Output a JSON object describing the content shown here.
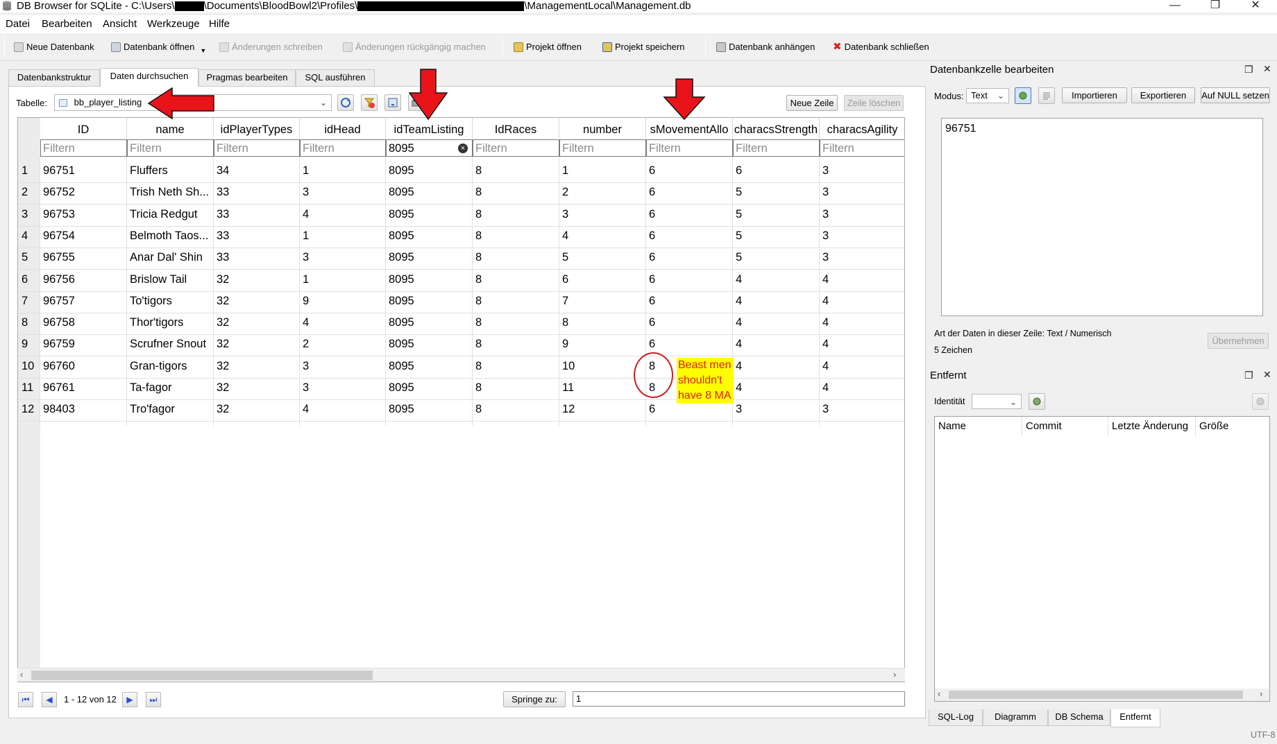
{
  "window": {
    "app_name": "DB Browser for SQLite",
    "title_part1": "DB Browser for SQLite - C:\\Users\\",
    "title_part2": "\\Documents\\BloodBowl2\\Profiles\\",
    "title_part3": "\\ManagementLocal\\Management.db",
    "minimize": "—",
    "restore": "❐",
    "close": "✕"
  },
  "menu": [
    "Datei",
    "Bearbeiten",
    "Ansicht",
    "Werkzeuge",
    "Hilfe"
  ],
  "toolbar": {
    "new_db": "Neue Datenbank",
    "open_db": "Datenbank öffnen",
    "write_changes": "Änderungen schreiben",
    "revert_changes": "Änderungen rückgängig machen",
    "open_project": "Projekt öffnen",
    "save_project": "Projekt speichern",
    "attach_db": "Datenbank anhängen",
    "close_db": "Datenbank schließen"
  },
  "tabs": [
    "Datenbankstruktur",
    "Daten durchsuchen",
    "Pragmas bearbeiten",
    "SQL ausführen"
  ],
  "browse": {
    "table_label": "Tabelle:",
    "table_value": "bb_player_listing",
    "new_row": "Neue Zeile",
    "delete_row": "Zeile löschen",
    "columns": [
      "ID",
      "name",
      "idPlayerTypes",
      "idHead",
      "idTeamListing",
      "IdRaces",
      "number",
      "sMovementAllo",
      "characsStrength",
      "characsAgility"
    ],
    "filters": [
      "Filtern",
      "Filtern",
      "Filtern",
      "Filtern",
      "8095",
      "Filtern",
      "Filtern",
      "Filtern",
      "Filtern",
      "Filtern"
    ],
    "rows": [
      [
        "1",
        "96751",
        "Fluffers",
        "34",
        "1",
        "8095",
        "8",
        "1",
        "6",
        "6",
        "3"
      ],
      [
        "2",
        "96752",
        "Trish Neth Sh...",
        "33",
        "3",
        "8095",
        "8",
        "2",
        "6",
        "5",
        "3"
      ],
      [
        "3",
        "96753",
        "Tricia Redgut",
        "33",
        "4",
        "8095",
        "8",
        "3",
        "6",
        "5",
        "3"
      ],
      [
        "4",
        "96754",
        "Belmoth Taos...",
        "33",
        "1",
        "8095",
        "8",
        "4",
        "6",
        "5",
        "3"
      ],
      [
        "5",
        "96755",
        "Anar Dal' Shin",
        "33",
        "3",
        "8095",
        "8",
        "5",
        "6",
        "5",
        "3"
      ],
      [
        "6",
        "96756",
        "Brislow Tail",
        "32",
        "1",
        "8095",
        "8",
        "6",
        "6",
        "4",
        "4"
      ],
      [
        "7",
        "96757",
        "To'tigors",
        "32",
        "9",
        "8095",
        "8",
        "7",
        "6",
        "4",
        "4"
      ],
      [
        "8",
        "96758",
        "Thor'tigors",
        "32",
        "4",
        "8095",
        "8",
        "8",
        "6",
        "4",
        "4"
      ],
      [
        "9",
        "96759",
        "Scrufner Snout",
        "32",
        "2",
        "8095",
        "8",
        "9",
        "6",
        "4",
        "4"
      ],
      [
        "10",
        "96760",
        "Gran-tigors",
        "32",
        "3",
        "8095",
        "8",
        "10",
        "8",
        "4",
        "4"
      ],
      [
        "11",
        "96761",
        "Ta-fagor",
        "32",
        "3",
        "8095",
        "8",
        "11",
        "8",
        "4",
        "4"
      ],
      [
        "12",
        "98403",
        "Tro'fagor",
        "32",
        "4",
        "8095",
        "8",
        "12",
        "6",
        "3",
        "3"
      ]
    ],
    "annotation_note": "Beast men shouldn't have 8 MA",
    "record_info": "1 - 12 von 12",
    "goto_label": "Springe zu:",
    "goto_value": "1"
  },
  "edit_cell": {
    "title": "Datenbankzelle bearbeiten",
    "mode_label": "Modus:",
    "mode_value": "Text",
    "import": "Importieren",
    "export": "Exportieren",
    "set_null": "Auf NULL setzen",
    "value": "96751",
    "type_info": "Art der Daten in dieser Zeile: Text / Numerisch",
    "char_count": "5 Zeichen",
    "apply": "Übernehmen"
  },
  "remote": {
    "title": "Entfernt",
    "identity_label": "Identität",
    "columns": [
      "Name",
      "Commit",
      "Letzte Änderung",
      "Größe"
    ]
  },
  "bottom_tabs": [
    "SQL-Log",
    "Diagramm",
    "DB Schema",
    "Entfernt"
  ],
  "status": {
    "encoding": "UTF-8"
  },
  "colors": {
    "annotation_red": "#e0201b",
    "note_bg": "#ffff00",
    "link_blue": "#2350c8"
  }
}
